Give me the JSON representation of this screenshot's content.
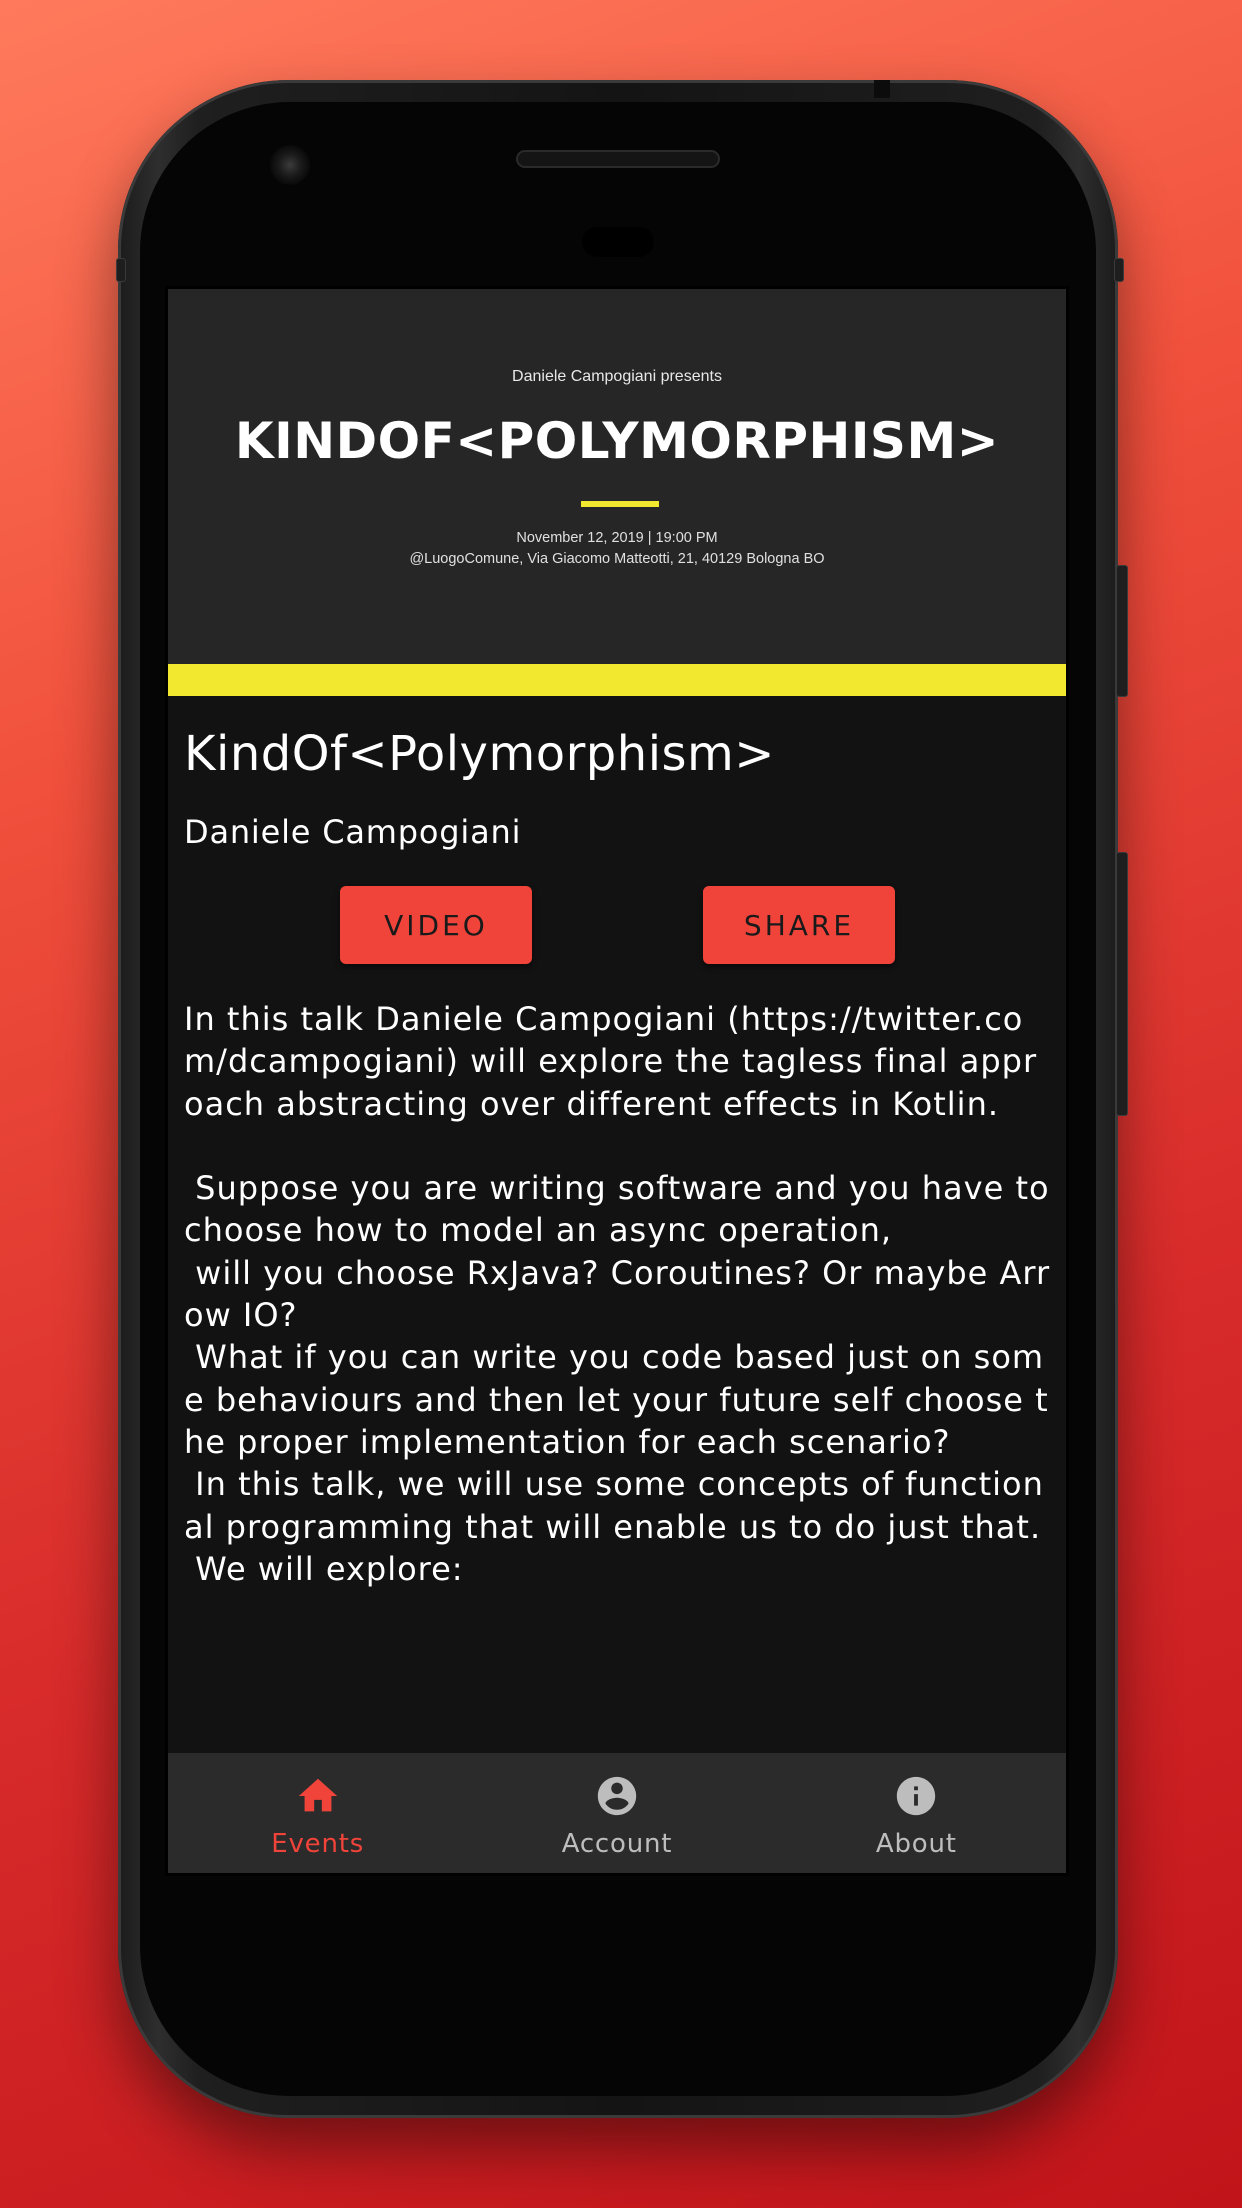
{
  "banner": {
    "presents": "Daniele Campogiani presents",
    "title": "KINDOF<POLYMORPHISM>",
    "date": "November 12, 2019 | 19:00 PM",
    "location": "@LuogoComune, Via Giacomo Matteotti, 21, 40129 Bologna BO"
  },
  "talk": {
    "title": "KindOf<Polymorphism>",
    "speaker": "Daniele Campogiani",
    "video_label": "VIDEO",
    "share_label": "SHARE",
    "description": "In this talk Daniele Campogiani (https://twitter.com/dcampogiani) will explore the tagless final approach abstracting over different effects in Kotlin.\n\n Suppose you are writing software and you have to choose how to model an async operation,\n will you choose RxJava? Coroutines? Or maybe Arrow IO?\n What if you can write you code based just on some behaviours and then let your future self choose the proper implementation for each scenario?\n In this talk, we will use some concepts of functional programming that will enable us to do just that.\n We will explore:"
  },
  "nav": {
    "items": [
      {
        "label": "Events",
        "icon": "home-icon",
        "active": true
      },
      {
        "label": "Account",
        "icon": "account-circle-icon",
        "active": false
      },
      {
        "label": "About",
        "icon": "info-icon",
        "active": false
      }
    ]
  },
  "colors": {
    "accent": "#f0443a",
    "highlight": "#f2e830",
    "banner_bg": "#262626",
    "content_bg": "#121212",
    "nav_bg": "#2b2b2b"
  }
}
